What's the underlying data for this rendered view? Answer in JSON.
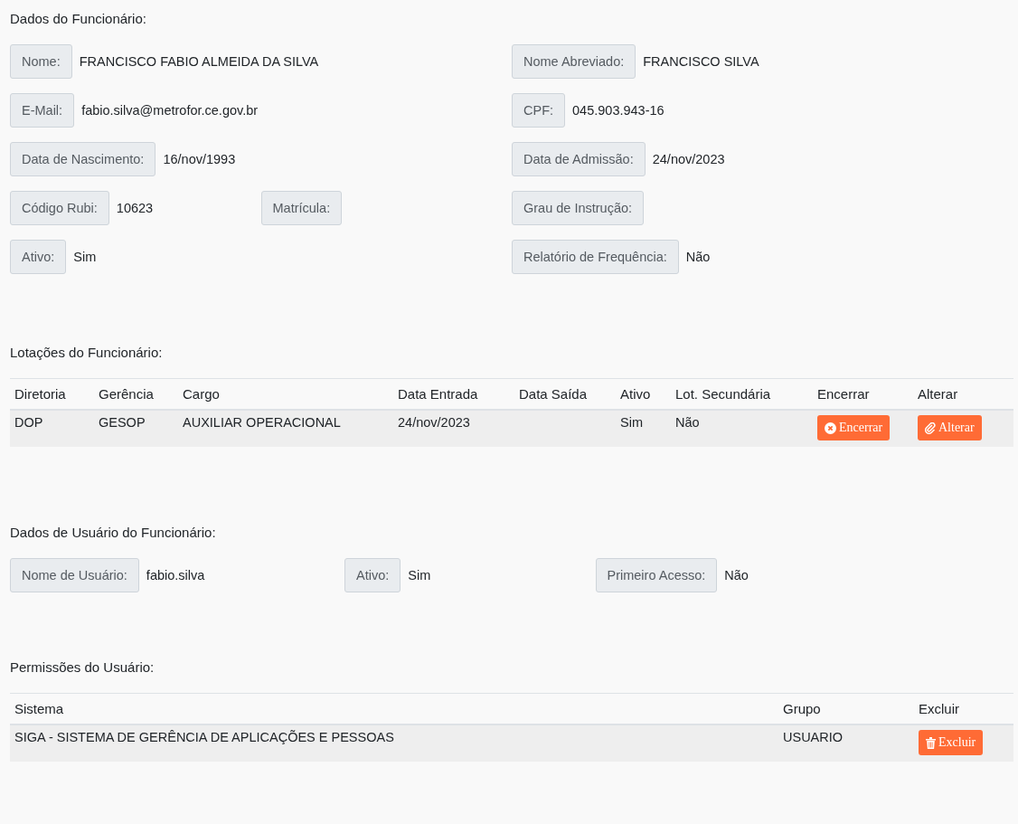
{
  "employee_data": {
    "title": "Dados do Funcionário:",
    "rows": [
      [
        {
          "label": "Nome:",
          "value": "FRANCISCO FABIO ALMEIDA DA SILVA"
        },
        {
          "label": "Nome Abreviado:",
          "value": "FRANCISCO SILVA"
        }
      ],
      [
        {
          "label": "E-Mail:",
          "value": "fabio.silva@metrofor.ce.gov.br"
        },
        {
          "label": "CPF:",
          "value": "045.903.943-16"
        }
      ],
      [
        {
          "label": "Data de Nascimento:",
          "value": "16/nov/1993"
        },
        {
          "label": "Data de Admissão:",
          "value": "24/nov/2023"
        }
      ],
      [
        {
          "label": "Código Rubi:",
          "value": "10623"
        },
        {
          "label": "Matrícula:"
        },
        {
          "label": "Grau de Instrução:"
        }
      ],
      [
        {
          "label": "Ativo:",
          "value": "Sim"
        },
        {
          "label": "Relatório de Frequência:",
          "value": "Não"
        }
      ]
    ]
  },
  "assignments": {
    "title": "Lotações do Funcionário:",
    "columns": [
      "Diretoria",
      "Gerência",
      "Cargo",
      "Data Entrada",
      "Data Saída",
      "Ativo",
      "Lot. Secundária",
      "Encerrar",
      "Alterar"
    ],
    "rows": [
      {
        "cells": [
          "DOP",
          "GESOP",
          "AUXILIAR OPERACIONAL",
          "24/nov/2023",
          "",
          "Sim",
          "Não"
        ],
        "buttons": [
          {
            "kind": "close",
            "label": "Encerrar"
          },
          {
            "kind": "edit",
            "label": "Alterar"
          }
        ]
      }
    ]
  },
  "user_data": {
    "title": "Dados de Usuário do Funcionário:",
    "fields": [
      {
        "label": "Nome de Usuário:",
        "value": "fabio.silva"
      },
      {
        "label": "Ativo:",
        "value": "Sim"
      },
      {
        "label": "Primeiro Acesso:",
        "value": "Não"
      }
    ]
  },
  "permissions": {
    "title": "Permissões do Usuário:",
    "columns": [
      "Sistema",
      "Grupo",
      "Excluir"
    ],
    "rows": [
      {
        "cells": [
          "SIGA - SISTEMA DE GERÊNCIA DE APLICAÇÕES E PESSOAS",
          "USUARIO"
        ],
        "buttons": [
          {
            "kind": "delete",
            "label": "Excluir"
          }
        ]
      }
    ]
  }
}
